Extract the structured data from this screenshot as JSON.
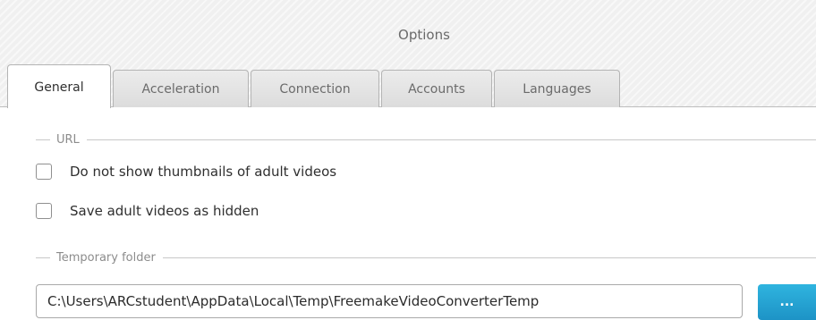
{
  "window": {
    "title": "Options"
  },
  "tabs": [
    {
      "label": "General",
      "active": true
    },
    {
      "label": "Acceleration",
      "active": false
    },
    {
      "label": "Connection",
      "active": false
    },
    {
      "label": "Accounts",
      "active": false
    },
    {
      "label": "Languages",
      "active": false
    }
  ],
  "url_group": {
    "label": "URL",
    "options": [
      {
        "label": "Do not show thumbnails of adult videos",
        "checked": false
      },
      {
        "label": "Save adult videos as hidden",
        "checked": false
      }
    ]
  },
  "temp_group": {
    "label": "Temporary folder",
    "path": "C:\\Users\\ARCstudent\\AppData\\Local\\Temp\\FreemakeVideoConverterTemp",
    "browse_label": "..."
  },
  "colors": {
    "accent": "#1d93c6",
    "active_tab": "#ffffff",
    "inactive_tab": "#dcdcdc"
  }
}
